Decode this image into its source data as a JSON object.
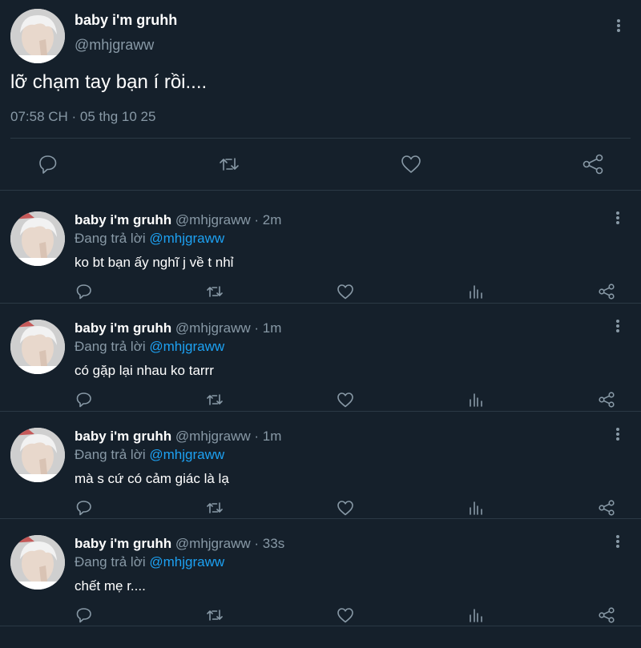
{
  "main_tweet": {
    "display_name": "baby i'm gruhh",
    "handle": "@mhjgraww",
    "text": "lỡ chạm tay bạn í rồi....",
    "timestamp": "07:58 CH · 05 thg 10 25",
    "actions": [
      "reply-icon",
      "retweet-icon",
      "like-icon",
      "share-icon"
    ]
  },
  "replies": [
    {
      "display_name": "baby i'm gruhh",
      "meta": "@mhjgraww · 2m",
      "replying_prefix": "Đang trả lời",
      "replying_to": "@mhjgraww",
      "text": "ko bt bạn ấy nghĩ j về t nhỉ"
    },
    {
      "display_name": "baby i'm gruhh",
      "meta": "@mhjgraww · 1m",
      "replying_prefix": "Đang trả lời",
      "replying_to": "@mhjgraww",
      "text": "có gặp lại nhau ko tarrr"
    },
    {
      "display_name": "baby i'm gruhh",
      "meta": "@mhjgraww · 1m",
      "replying_prefix": "Đang trả lời",
      "replying_to": "@mhjgraww",
      "text": "mà s cứ có cảm giác là lạ"
    },
    {
      "display_name": "baby i'm gruhh",
      "meta": "@mhjgraww · 33s",
      "replying_prefix": "Đang trả lời",
      "replying_to": "@mhjgraww",
      "text": "chết mẹ r...."
    }
  ],
  "reply_actions": [
    "reply-icon",
    "retweet-icon",
    "like-icon",
    "analytics-icon",
    "share-icon"
  ],
  "colors": {
    "background": "#15202b",
    "text": "#ffffff",
    "secondary_text": "#8899a6",
    "accent": "#1da1f2",
    "divider": "#2b3945"
  }
}
